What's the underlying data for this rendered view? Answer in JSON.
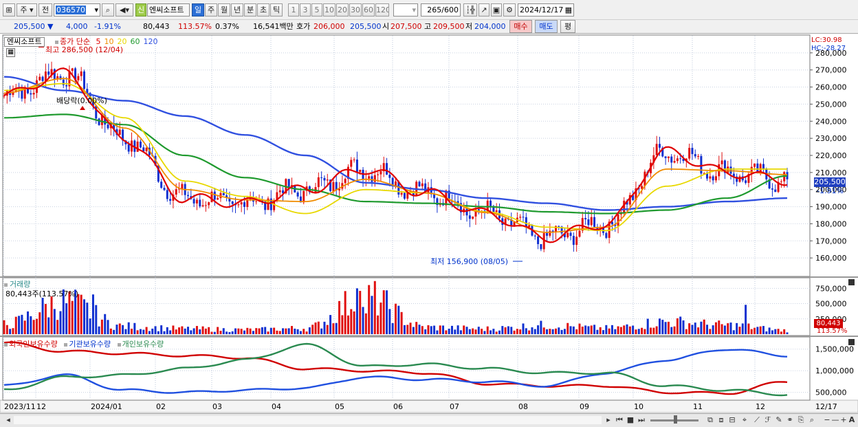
{
  "toolbar": {
    "mode_select": "주",
    "prev_btn": "전",
    "code_value": "036570",
    "stock_name": "엔씨소프트",
    "stock_tag": "신",
    "period_tabs": [
      "일",
      "주",
      "월",
      "년",
      "분",
      "초",
      "틱"
    ],
    "interval_btns": [
      "1",
      "3",
      "5",
      "10",
      "20",
      "30",
      "60",
      "120"
    ],
    "count_display": "265",
    "count_total": "/600",
    "date_value": "2024/12/17"
  },
  "quote_bar": {
    "price": "205,500",
    "change": "4,000",
    "change_pct": "-1.91%",
    "volume": "80,443",
    "vol_ratio": "113.57%",
    "turnover_pct": "0.37%",
    "amount": "16,541",
    "amount_unit": "백만",
    "ask_label": "호가",
    "ask_price": "206,000",
    "bid_price": "205,500",
    "open_label": "시",
    "open": "207,500",
    "high_label": "고",
    "high": "209,500",
    "low_label": "저",
    "low": "204,000",
    "buy_label": "매수",
    "sell_label": "매도",
    "avg_label": "평"
  },
  "price_panel": {
    "stock_tag": "엔씨소프트",
    "ma_title": "종가 단순",
    "ma_periods": [
      "5",
      "10",
      "20",
      "60",
      "120"
    ],
    "ma_colors": [
      "#e00000",
      "#f08c00",
      "#e8d800",
      "#1f9a2e",
      "#3050e0"
    ],
    "lc": "LC:30.98",
    "hc": "HC:-28.27",
    "high_note": "최고 286,500 (12/04)",
    "low_note": "최저 156,900 (08/05)",
    "dividend_note": "배당락(0.00%)",
    "current_price": "205,500",
    "current_change": "-1.91%",
    "y_ticks": [
      "280,000",
      "270,000",
      "260,000",
      "250,000",
      "240,000",
      "230,000",
      "220,000",
      "210,000",
      "200,000",
      "190,000",
      "180,000",
      "170,000",
      "160,000"
    ]
  },
  "volume_panel": {
    "title": "거래량",
    "last_label": "80,443주(113.57%)",
    "current": "80,443",
    "current_pct": "113.57%",
    "y_ticks": [
      "750,000",
      "500,000",
      "250,000"
    ]
  },
  "holding_panel": {
    "legend": [
      "외국인보유수량",
      "기관보유수량",
      "개인보유수량"
    ],
    "colors": [
      "#d00000",
      "#2050e0",
      "#2a8a50"
    ],
    "y_ticks": [
      "1,500,000",
      "1,000,000",
      "500,000"
    ]
  },
  "x_axis": {
    "labels": [
      "2023/11",
      "12",
      "2024/01",
      "02",
      "03",
      "04",
      "05",
      "06",
      "07",
      "08",
      "09",
      "10",
      "11",
      "12"
    ],
    "end_label": "12/17"
  },
  "chart_data": [
    {
      "type": "line",
      "title": "",
      "note": "approximate daily price path (KRW) read from candles and moving averages",
      "x": [
        "2023/11",
        "2023/12",
        "2024/01",
        "2024/02",
        "2024/03",
        "2024/04",
        "2024/05",
        "2024/06",
        "2024/07",
        "2024/08",
        "2024/09",
        "2024/10",
        "2024/11",
        "2024/12"
      ],
      "series": [
        {
          "name": "5",
          "values": [
            255000,
            268000,
            230000,
            195000,
            192000,
            200000,
            212000,
            198000,
            186000,
            172000,
            180000,
            222000,
            210000,
            205500
          ]
        },
        {
          "name": "20",
          "values": [
            258000,
            262000,
            242000,
            205000,
            196000,
            186000,
            200000,
            198000,
            187000,
            178000,
            176000,
            202000,
            212000,
            212000
          ]
        },
        {
          "name": "60",
          "values": [
            242000,
            244000,
            238000,
            220000,
            207000,
            200000,
            193000,
            192000,
            190000,
            187000,
            186000,
            188000,
            195000,
            208000
          ]
        },
        {
          "name": "120",
          "values": [
            266000,
            258000,
            252000,
            243000,
            232000,
            220000,
            204000,
            200000,
            195000,
            192000,
            188000,
            190000,
            193000,
            195000
          ]
        }
      ],
      "ylim": [
        150000,
        290000
      ],
      "annotations": {
        "high": [
          286500,
          "12/04"
        ],
        "low": [
          156900,
          "08/05"
        ]
      }
    },
    {
      "type": "bar",
      "title": "",
      "x": [
        "2023/11",
        "2023/12",
        "2024/01",
        "2024/02",
        "2024/03",
        "2024/04",
        "2024/05",
        "2024/06",
        "2024/07",
        "2024/08",
        "2024/09",
        "2024/10",
        "2024/11",
        "2024/12"
      ],
      "values": [
        200000,
        650000,
        160000,
        110000,
        90000,
        120000,
        750000,
        140000,
        110000,
        180000,
        120000,
        250000,
        180000,
        80443
      ],
      "ylim": [
        0,
        900000
      ]
    },
    {
      "type": "line",
      "title": "",
      "x": [
        "2023/11",
        "2023/12",
        "2024/01",
        "2024/02",
        "2024/03",
        "2024/04",
        "2024/05",
        "2024/06",
        "2024/07",
        "2024/08",
        "2024/09",
        "2024/10",
        "2024/11",
        "2024/12"
      ],
      "series": [
        {
          "name": "외국인보유수량",
          "values": [
            1650000,
            1450000,
            1400000,
            1350000,
            1300000,
            1050000,
            1000000,
            950000,
            700000,
            650000,
            650000,
            500000,
            480000,
            750000
          ]
        },
        {
          "name": "기관보유수량",
          "values": [
            650000,
            900000,
            550000,
            500000,
            550000,
            600000,
            850000,
            800000,
            750000,
            650000,
            950000,
            1250000,
            1500000,
            1350000
          ]
        },
        {
          "name": "개인보유수량",
          "values": [
            550000,
            850000,
            900000,
            1050000,
            1250000,
            1600000,
            1100000,
            1150000,
            1050000,
            950000,
            950000,
            650000,
            550000,
            450000
          ]
        }
      ],
      "ylim": [
        350000,
        1750000
      ]
    }
  ]
}
